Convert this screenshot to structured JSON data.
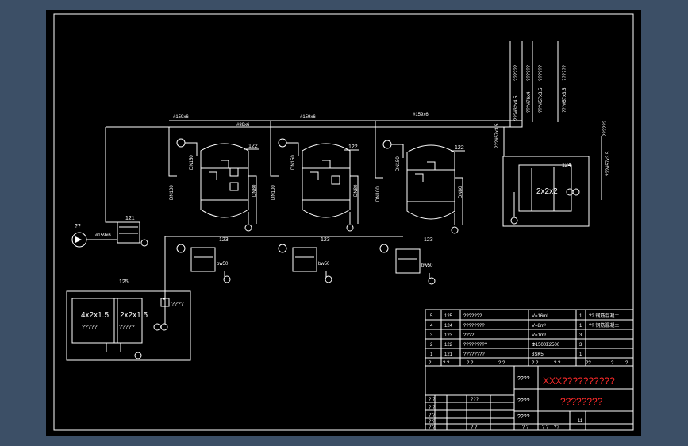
{
  "drawing": {
    "pipe_labels": [
      "#159x6",
      "#159x6",
      "#159x6",
      "#89x6"
    ],
    "vertical_pipe_labels": [
      "??????",
      "??????",
      "??????",
      "??????"
    ],
    "vertical_pipe_specs": [
      "???#32x4.5",
      "???#76x4",
      "???#57x3.5",
      "???#57x3.5"
    ],
    "right_pipe_label": "??????",
    "right_pipe_spec": "???#57x3.5",
    "right_small_spec": "???#57x3.5",
    "tanks": [
      {
        "tag": "122",
        "dn_left": "DN100",
        "dn_mid": "DN150",
        "dn_right": "DN80"
      },
      {
        "tag": "122",
        "dn_left": "DN100",
        "dn_mid": "DN150",
        "dn_right": "DN80"
      },
      {
        "tag": "122",
        "dn_left": "DN100",
        "dn_mid": "DN150",
        "dn_right": "DN80"
      }
    ],
    "pump_tags": [
      "123",
      "123",
      "123"
    ],
    "pump_size": "bw50",
    "left_unit": {
      "tag": "121",
      "arrow_label": "??",
      "pipe_label": "#159x6"
    },
    "cooling_unit": {
      "tag": "124",
      "dims": "2x2x2"
    },
    "bottom_unit": {
      "tag": "125",
      "left_dims": "4x2x1.5",
      "left_sub": "?????",
      "right_dims": "2x2x1.5",
      "right_sub": "?????",
      "side_label": "????"
    }
  },
  "parts_table": {
    "rows": [
      {
        "no": "5",
        "tag": "125",
        "name": "???????",
        "spec": "V=16m³",
        "qty": "1",
        "note": "??  钢筋混凝土"
      },
      {
        "no": "4",
        "tag": "124",
        "name": "????????",
        "spec": "V=8m³",
        "qty": "1",
        "note": "??  钢筋混凝土"
      },
      {
        "no": "3",
        "tag": "123",
        "name": "????",
        "spec": "V=1m³",
        "qty": "3",
        "note": ""
      },
      {
        "no": "2",
        "tag": "122",
        "name": "?????????",
        "spec": "Φ1500Σ2500",
        "qty": "3",
        "note": ""
      },
      {
        "no": "1",
        "tag": "121",
        "name": "????????",
        "spec": "3SK5",
        "qty": "1",
        "note": ""
      }
    ],
    "header": [
      "?",
      "? ?",
      "? ?",
      "? ?",
      "? ?",
      "? ?",
      "??",
      "?",
      "?"
    ]
  },
  "title_block": {
    "label_a": "????",
    "label_b": "????",
    "label_c": "????",
    "title_red": "XXX??????????",
    "subtitle_red": "????????",
    "small_cells": [
      "? ?",
      "? ?",
      "???",
      "? ?",
      "? ?",
      "? ?",
      "? ?",
      "? ?",
      "? ?",
      "??"
    ],
    "page_mark": "11"
  },
  "colors": {
    "background": "#3c4f66",
    "sheet": "#000000",
    "lines": "#ffffff",
    "accent": "#ffff66",
    "title_text": "#ff2a2a"
  }
}
